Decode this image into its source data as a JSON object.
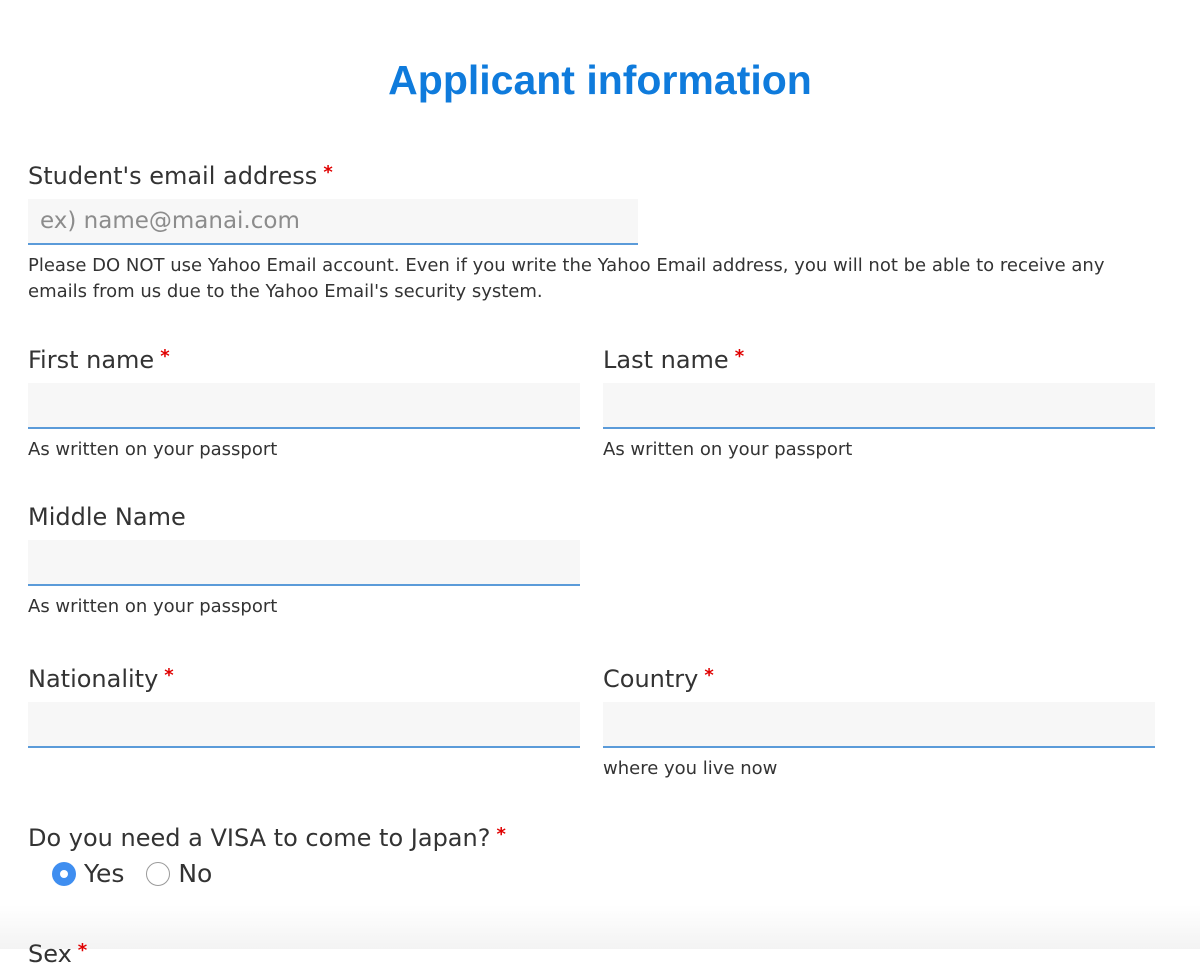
{
  "colors": {
    "title": "#0f7bdc",
    "required": "#e00000",
    "input_border": "#5b9bd9",
    "radio_checked": "#3f8ef0"
  },
  "form": {
    "title": "Applicant information",
    "required_mark": "*",
    "email": {
      "label": "Student's email address",
      "value": "",
      "placeholder": "ex) name@manai.com",
      "help": "Please DO NOT use Yahoo Email account. Even if you write the Yahoo Email address, you will not be able to receive any emails from us due to the Yahoo Email's security system."
    },
    "first_name": {
      "label": "First name",
      "value": "",
      "help": "As written on your passport"
    },
    "last_name": {
      "label": "Last name",
      "value": "",
      "help": "As written on your passport"
    },
    "middle_name": {
      "label": "Middle Name",
      "value": "",
      "help": "As written on your passport"
    },
    "nationality": {
      "label": "Nationality",
      "value": ""
    },
    "country": {
      "label": "Country",
      "value": "",
      "help": "where you live now"
    },
    "visa": {
      "label": "Do you need a VISA to come to Japan?",
      "options": [
        "Yes",
        "No"
      ],
      "selected": "Yes"
    },
    "next_field_partial": "Sex"
  }
}
